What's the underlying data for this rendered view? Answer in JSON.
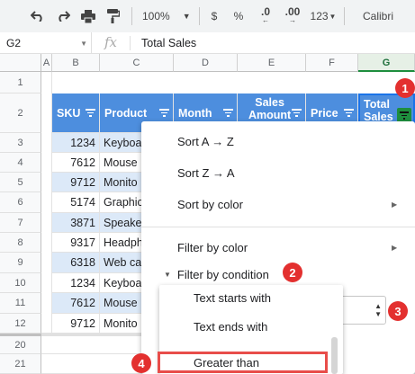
{
  "toolbar": {
    "zoom": "100%",
    "currency": "$",
    "percent": "%",
    "dec_decrease": ".0",
    "dec_increase": ".00",
    "more_formats": "123",
    "font": "Calibri"
  },
  "formula_bar": {
    "cell_ref": "G2",
    "fx": "fx",
    "content": "Total Sales"
  },
  "columns": [
    "A",
    "B",
    "C",
    "D",
    "E",
    "F",
    "G"
  ],
  "row_numbers": [
    "1",
    "2",
    "3",
    "4",
    "5",
    "6",
    "7",
    "8",
    "9",
    "10",
    "11",
    "12",
    "20",
    "21"
  ],
  "headers": {
    "sku": "SKU",
    "product": "Product",
    "month": "Month",
    "sales_amount": "Sales\nAmount",
    "price": "Price",
    "total_sales": "Total\nSales"
  },
  "rows": [
    {
      "sku": "1234",
      "product": "Keyboa"
    },
    {
      "sku": "7612",
      "product": "Mouse"
    },
    {
      "sku": "9712",
      "product": "Monito"
    },
    {
      "sku": "5174",
      "product": "Graphic"
    },
    {
      "sku": "3871",
      "product": "Speake"
    },
    {
      "sku": "9317",
      "product": "Headph"
    },
    {
      "sku": "6318",
      "product": "Web ca"
    },
    {
      "sku": "1234",
      "product": "Keyboa"
    },
    {
      "sku": "7612",
      "product": "Mouse"
    },
    {
      "sku": "9712",
      "product": "Monito"
    }
  ],
  "menu": {
    "sort_az": "Sort A → Z",
    "sort_za": "Sort Z → A",
    "sort_color": "Sort by color",
    "filter_color": "Filter by color",
    "filter_condition": "Filter by condition"
  },
  "condition_list": {
    "items": [
      "Text starts with",
      "Text ends with",
      "Greater than"
    ]
  },
  "badges": [
    "1",
    "2",
    "3",
    "4"
  ],
  "colors": {
    "header_blue": "#4d8ede",
    "band_light": "#dce9f8",
    "badge_red": "#e3302f",
    "highlight_border": "#e84d4a"
  }
}
